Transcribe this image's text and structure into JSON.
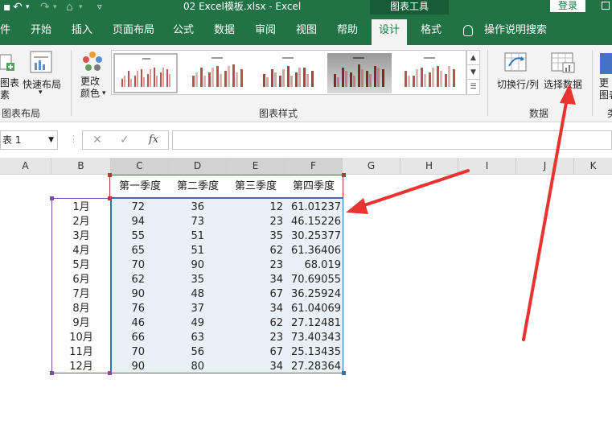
{
  "titlebar": {
    "title": "02 Excel模板.xlsx  -  Excel",
    "chart_tools": "图表工具",
    "login": "登录"
  },
  "tabs": [
    {
      "label": "件",
      "active": false
    },
    {
      "label": "开始",
      "active": false
    },
    {
      "label": "插入",
      "active": false
    },
    {
      "label": "页面布局",
      "active": false
    },
    {
      "label": "公式",
      "active": false
    },
    {
      "label": "数据",
      "active": false
    },
    {
      "label": "审阅",
      "active": false
    },
    {
      "label": "视图",
      "active": false
    },
    {
      "label": "帮助",
      "active": false
    },
    {
      "label": "设计",
      "active": true
    },
    {
      "label": "格式",
      "active": false
    }
  ],
  "tell_me": "操作说明搜索",
  "ribbon": {
    "add_chart_element": "图表\n素",
    "quick_layout": "快速布局",
    "group_chart_layouts": "图表布局",
    "change_colors": "更改\n颜色",
    "group_chart_styles": "图表样式",
    "switch_row_col": "切换行/列",
    "select_data": "选择数据",
    "group_data": "数据",
    "change_type": "更\n图表",
    "group_type": "类"
  },
  "formula_bar": {
    "name_box": "表 1",
    "cancel_icon": "✕",
    "enter_icon": "✓",
    "fx": "fx",
    "value": ""
  },
  "columns": [
    "A",
    "B",
    "C",
    "D",
    "E",
    "F",
    "G",
    "H",
    "I",
    "J",
    "K"
  ],
  "table": {
    "headers": [
      "第一季度",
      "第二季度",
      "第三季度",
      "第四季度"
    ],
    "rows": [
      {
        "month": "1月",
        "q1": "72",
        "q2": "36",
        "q3": "12",
        "q4": "61.01237"
      },
      {
        "month": "2月",
        "q1": "94",
        "q2": "73",
        "q3": "23",
        "q4": "46.15226"
      },
      {
        "month": "3月",
        "q1": "55",
        "q2": "51",
        "q3": "35",
        "q4": "30.25377"
      },
      {
        "month": "4月",
        "q1": "65",
        "q2": "51",
        "q3": "62",
        "q4": "61.36406"
      },
      {
        "month": "5月",
        "q1": "70",
        "q2": "90",
        "q3": "23",
        "q4": "68.019"
      },
      {
        "month": "6月",
        "q1": "62",
        "q2": "35",
        "q3": "34",
        "q4": "70.69055"
      },
      {
        "month": "7月",
        "q1": "90",
        "q2": "48",
        "q3": "67",
        "q4": "36.25924"
      },
      {
        "month": "8月",
        "q1": "76",
        "q2": "37",
        "q3": "34",
        "q4": "61.04069"
      },
      {
        "month": "9月",
        "q1": "46",
        "q2": "49",
        "q3": "62",
        "q4": "27.12481"
      },
      {
        "month": "10月",
        "q1": "66",
        "q2": "63",
        "q3": "23",
        "q4": "73.40343"
      },
      {
        "month": "11月",
        "q1": "70",
        "q2": "56",
        "q3": "67",
        "q4": "25.13435"
      },
      {
        "month": "12月",
        "q1": "90",
        "q2": "80",
        "q3": "34",
        "q4": "27.28364"
      }
    ]
  },
  "colors": {
    "excel_green": "#217346",
    "arrow_red": "#e8332f",
    "range_red": "#b23b3b",
    "range_purple": "#7a4fa3",
    "range_blue": "#3a6fb7"
  }
}
